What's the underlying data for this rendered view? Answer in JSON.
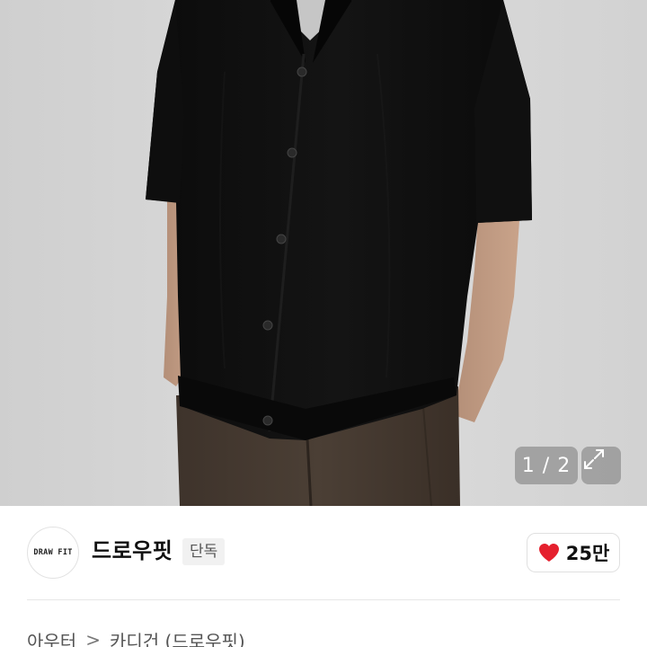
{
  "photo": {
    "pager": "1 / 2",
    "expand_icon": "expand-arrows-icon"
  },
  "brand": {
    "logo_text": "DRAW FIT",
    "name": "드로우핏",
    "badge": "단독"
  },
  "like": {
    "icon": "heart-icon",
    "icon_color": "#e5202e",
    "count": "25만"
  },
  "breadcrumb": {
    "items": [
      "아우터",
      "카디건 (드로우핏)"
    ],
    "separator": ">"
  }
}
